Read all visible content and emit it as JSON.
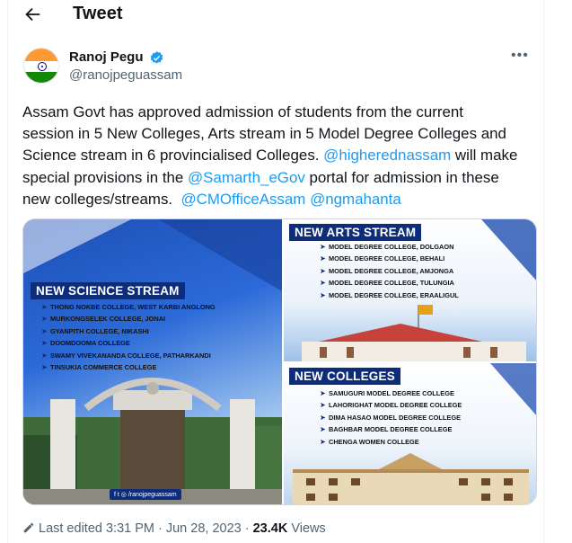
{
  "header": {
    "title": "Tweet"
  },
  "author": {
    "name": "Ranoj Pegu",
    "handle": "@ranojpeguassam"
  },
  "tweet": {
    "line1": "Assam Govt has approved admission of students from the current",
    "line2": "session in 5 New Colleges, Arts stream in 5 Model Degree Colleges and",
    "line3": "Science stream in 6 provincialised Colleges.",
    "mention1": "@higherednassam",
    "line4a": "will make",
    "line5a": "special provisions in the",
    "mention2": "@Samarth_eGov",
    "line5b": "portal for admission in these",
    "line6a": "new colleges/streams.",
    "mention3": "@CMOfficeAssam",
    "mention4": "@ngmahanta"
  },
  "media": {
    "science": {
      "title": "NEW SCIENCE STREAM",
      "items": [
        "THONG NOKBE COLLEGE, WEST KARBI ANGLONG",
        "MURKONGSELEK COLLEGE, JONAI",
        "GYANPITH COLLEGE, NIKASHI",
        "DOOMDOOMA COLLEGE",
        "SWAMY VIVEKANANDA COLLEGE, PATHARKANDI",
        "TINSUKIA COMMERCE COLLEGE"
      ],
      "social": "/ranojpeguassam"
    },
    "arts": {
      "title": "NEW ARTS STREAM",
      "items": [
        "MODEL DEGREE COLLEGE, DOLGAON",
        "MODEL DEGREE COLLEGE, BEHALI",
        "MODEL DEGREE COLLEGE, AMJONGA",
        "MODEL DEGREE COLLEGE, TULUNGIA",
        "MODEL DEGREE COLLEGE, ERAALIGUL"
      ]
    },
    "colleges": {
      "title": "NEW COLLEGES",
      "items": [
        "SAMUGURI MODEL DEGREE COLLEGE",
        "LAHORIGHAT MODEL DEGREE COLLEGE",
        "DIMA HASAO MODEL DEGREE COLLEGE",
        "BAGHBAR MODEL DEGREE COLLEGE",
        "CHENGA WOMEN COLLEGE"
      ]
    }
  },
  "footer": {
    "edited": "Last edited 3:31 PM · Jun 28, 2023 ·",
    "views_count": "23.4K",
    "views_label": "Views"
  },
  "colors": {
    "accent": "#1d9bf0",
    "banner": "#0d2d7a"
  }
}
